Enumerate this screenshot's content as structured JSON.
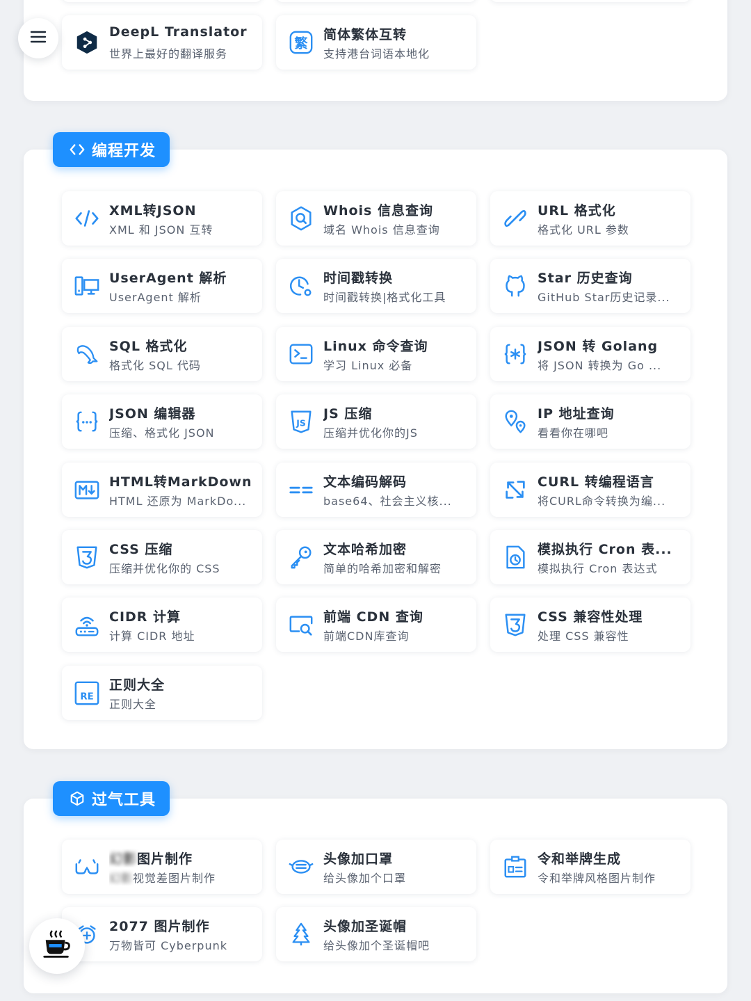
{
  "sections": {
    "translation": {
      "tools": [
        {
          "title": "DeepL Translator",
          "desc": "世界上最好的翻译服务",
          "icon": "deepl-icon"
        },
        {
          "title": "简体繁体互转",
          "desc": "支持港台词语本地化",
          "icon": "traditional-chinese-icon"
        }
      ]
    },
    "programming": {
      "label": "编程开发",
      "icon": "code-brackets-icon",
      "tools": [
        {
          "title": "XML转JSON",
          "desc": "XML 和 JSON 互转",
          "icon": "code-icon"
        },
        {
          "title": "Whois 信息查询",
          "desc": "域名 Whois 信息查询",
          "icon": "search-badge-icon"
        },
        {
          "title": "URL 格式化",
          "desc": "格式化 URL 参数",
          "icon": "link-icon"
        },
        {
          "title": "UserAgent 解析",
          "desc": "UserAgent 解析",
          "icon": "devices-icon"
        },
        {
          "title": "时间戳转换",
          "desc": "时间戳转换|格式化工具",
          "icon": "clock-icon"
        },
        {
          "title": "Star 历史查询",
          "desc": "GitHub Star历史记录...",
          "icon": "github-icon"
        },
        {
          "title": "SQL 格式化",
          "desc": "格式化 SQL 代码",
          "icon": "dolphin-icon"
        },
        {
          "title": "Linux 命令查询",
          "desc": "学习 Linux 必备",
          "icon": "terminal-icon"
        },
        {
          "title": "JSON 转 Golang",
          "desc": "将 JSON 转换为 Go ...",
          "icon": "braces-star-icon"
        },
        {
          "title": "JSON 编辑器",
          "desc": "压缩、格式化 JSON",
          "icon": "braces-dots-icon"
        },
        {
          "title": "JS 压缩",
          "desc": "压缩并优化你的JS",
          "icon": "js-shield-icon"
        },
        {
          "title": "IP 地址查询",
          "desc": "看看你在哪吧",
          "icon": "location-pins-icon"
        },
        {
          "title": "HTML转MarkDown",
          "desc": "HTML 还原为 MarkDo...",
          "icon": "markdown-icon"
        },
        {
          "title": "文本编码解码",
          "desc": "base64、社会主义核...",
          "icon": "equals-icon"
        },
        {
          "title": "CURL 转编程语言",
          "desc": "将CURL命令转换为编...",
          "icon": "arrows-expand-icon"
        },
        {
          "title": "CSS 压缩",
          "desc": "压缩并优化你的 CSS",
          "icon": "css-shield-icon"
        },
        {
          "title": "文本哈希加密",
          "desc": "简单的哈希加密和解密",
          "icon": "key-icon"
        },
        {
          "title": "模拟执行 Cron 表...",
          "desc": "模拟执行 Cron 表达式",
          "icon": "clock-file-icon"
        },
        {
          "title": "CIDR 计算",
          "desc": "计算 CIDR 地址",
          "icon": "router-icon"
        },
        {
          "title": "前端 CDN 查询",
          "desc": "前端CDN库查询",
          "icon": "screen-search-icon"
        },
        {
          "title": "CSS 兼容性处理",
          "desc": "处理 CSS 兼容性",
          "icon": "css-shield-icon"
        },
        {
          "title": "正则大全",
          "desc": "正则大全",
          "icon": "regex-icon"
        }
      ]
    },
    "legacy": {
      "label": "过气工具",
      "icon": "cube-icon",
      "tools": [
        {
          "title": "图片制作",
          "title_prefix_blurred": "幻影",
          "desc": "视觉差图片制作",
          "desc_prefix_blurred": "幻影",
          "icon": "glasses-icon"
        },
        {
          "title": "头像加口罩",
          "desc": "给头像加个口罩",
          "icon": "mask-icon"
        },
        {
          "title": "令和举牌生成",
          "desc": "令和举牌风格图片制作",
          "icon": "id-card-icon"
        },
        {
          "title": "2077 图片制作",
          "desc": "万物皆可 Cyberpunk",
          "icon": "cyber-icon"
        },
        {
          "title": "头像加圣诞帽",
          "desc": "给头像加个圣诞帽吧",
          "icon": "christmas-tree-icon"
        }
      ]
    }
  },
  "colors": {
    "accent": "#1e90ff",
    "icon": "#2b8ff3",
    "panel": "#ffffff",
    "background": "#eff1f4"
  }
}
